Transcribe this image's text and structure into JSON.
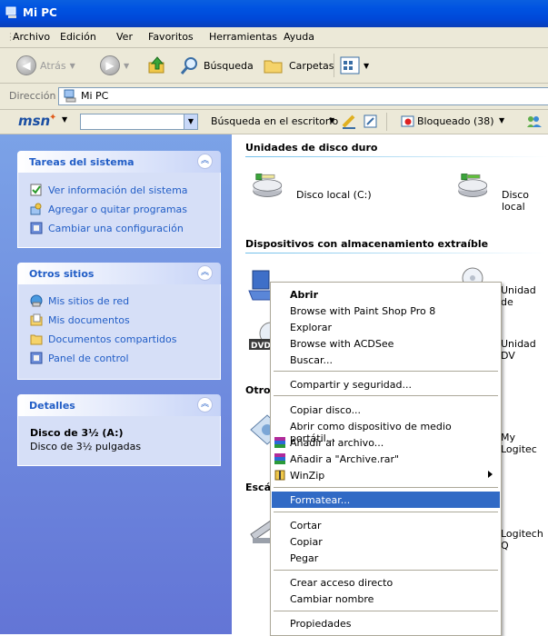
{
  "window": {
    "title": "Mi PC"
  },
  "menubar": [
    "Archivo",
    "Edición",
    "Ver",
    "Favoritos",
    "Herramientas",
    "Ayuda"
  ],
  "toolbar": {
    "back": "Atrás",
    "search": "Búsqueda",
    "folders": "Carpetas"
  },
  "address": {
    "label": "Dirección",
    "value": "Mi PC"
  },
  "msnbar": {
    "brand": "msn",
    "desktop_search": "Búsqueda en el escritorio",
    "blocked": "Bloqueado (38)"
  },
  "left": {
    "system_tasks": {
      "title": "Tareas del sistema",
      "items": [
        "Ver información del sistema",
        "Agregar o quitar programas",
        "Cambiar una configuración"
      ]
    },
    "other_places": {
      "title": "Otros sitios",
      "items": [
        "Mis sitios de red",
        "Mis documentos",
        "Documentos compartidos",
        "Panel de control"
      ]
    },
    "details": {
      "title": "Detalles",
      "name": "Disco de 3½ (A:)",
      "desc": "Disco de 3½ pulgadas"
    }
  },
  "right": {
    "hard_drives": {
      "title": "Unidades de disco duro",
      "items": [
        "Disco local (C:)",
        "Disco local"
      ]
    },
    "removable": {
      "title": "Dispositivos con almacenamiento extraíble",
      "items": [
        "Unidad de",
        "Unidad DV"
      ]
    },
    "other": {
      "title": "Otros",
      "items": [
        "My Logitec"
      ]
    },
    "scanners": {
      "title": "Escá",
      "items": [
        "Logitech Q"
      ]
    }
  },
  "context_menu": {
    "items": [
      "Abrir",
      "Browse with Paint Shop Pro 8",
      "Explorar",
      "Browse with ACDSee",
      "Buscar...",
      "Compartir y seguridad...",
      "Copiar disco...",
      "Abrir como dispositivo de medio portátil...",
      "Añadir al archivo...",
      "Añadir a \"Archive.rar\"",
      "WinZip",
      "Formatear...",
      "Cortar",
      "Copiar",
      "Pegar",
      "Crear acceso directo",
      "Cambiar nombre",
      "Propiedades"
    ],
    "selected": "Formatear..."
  }
}
